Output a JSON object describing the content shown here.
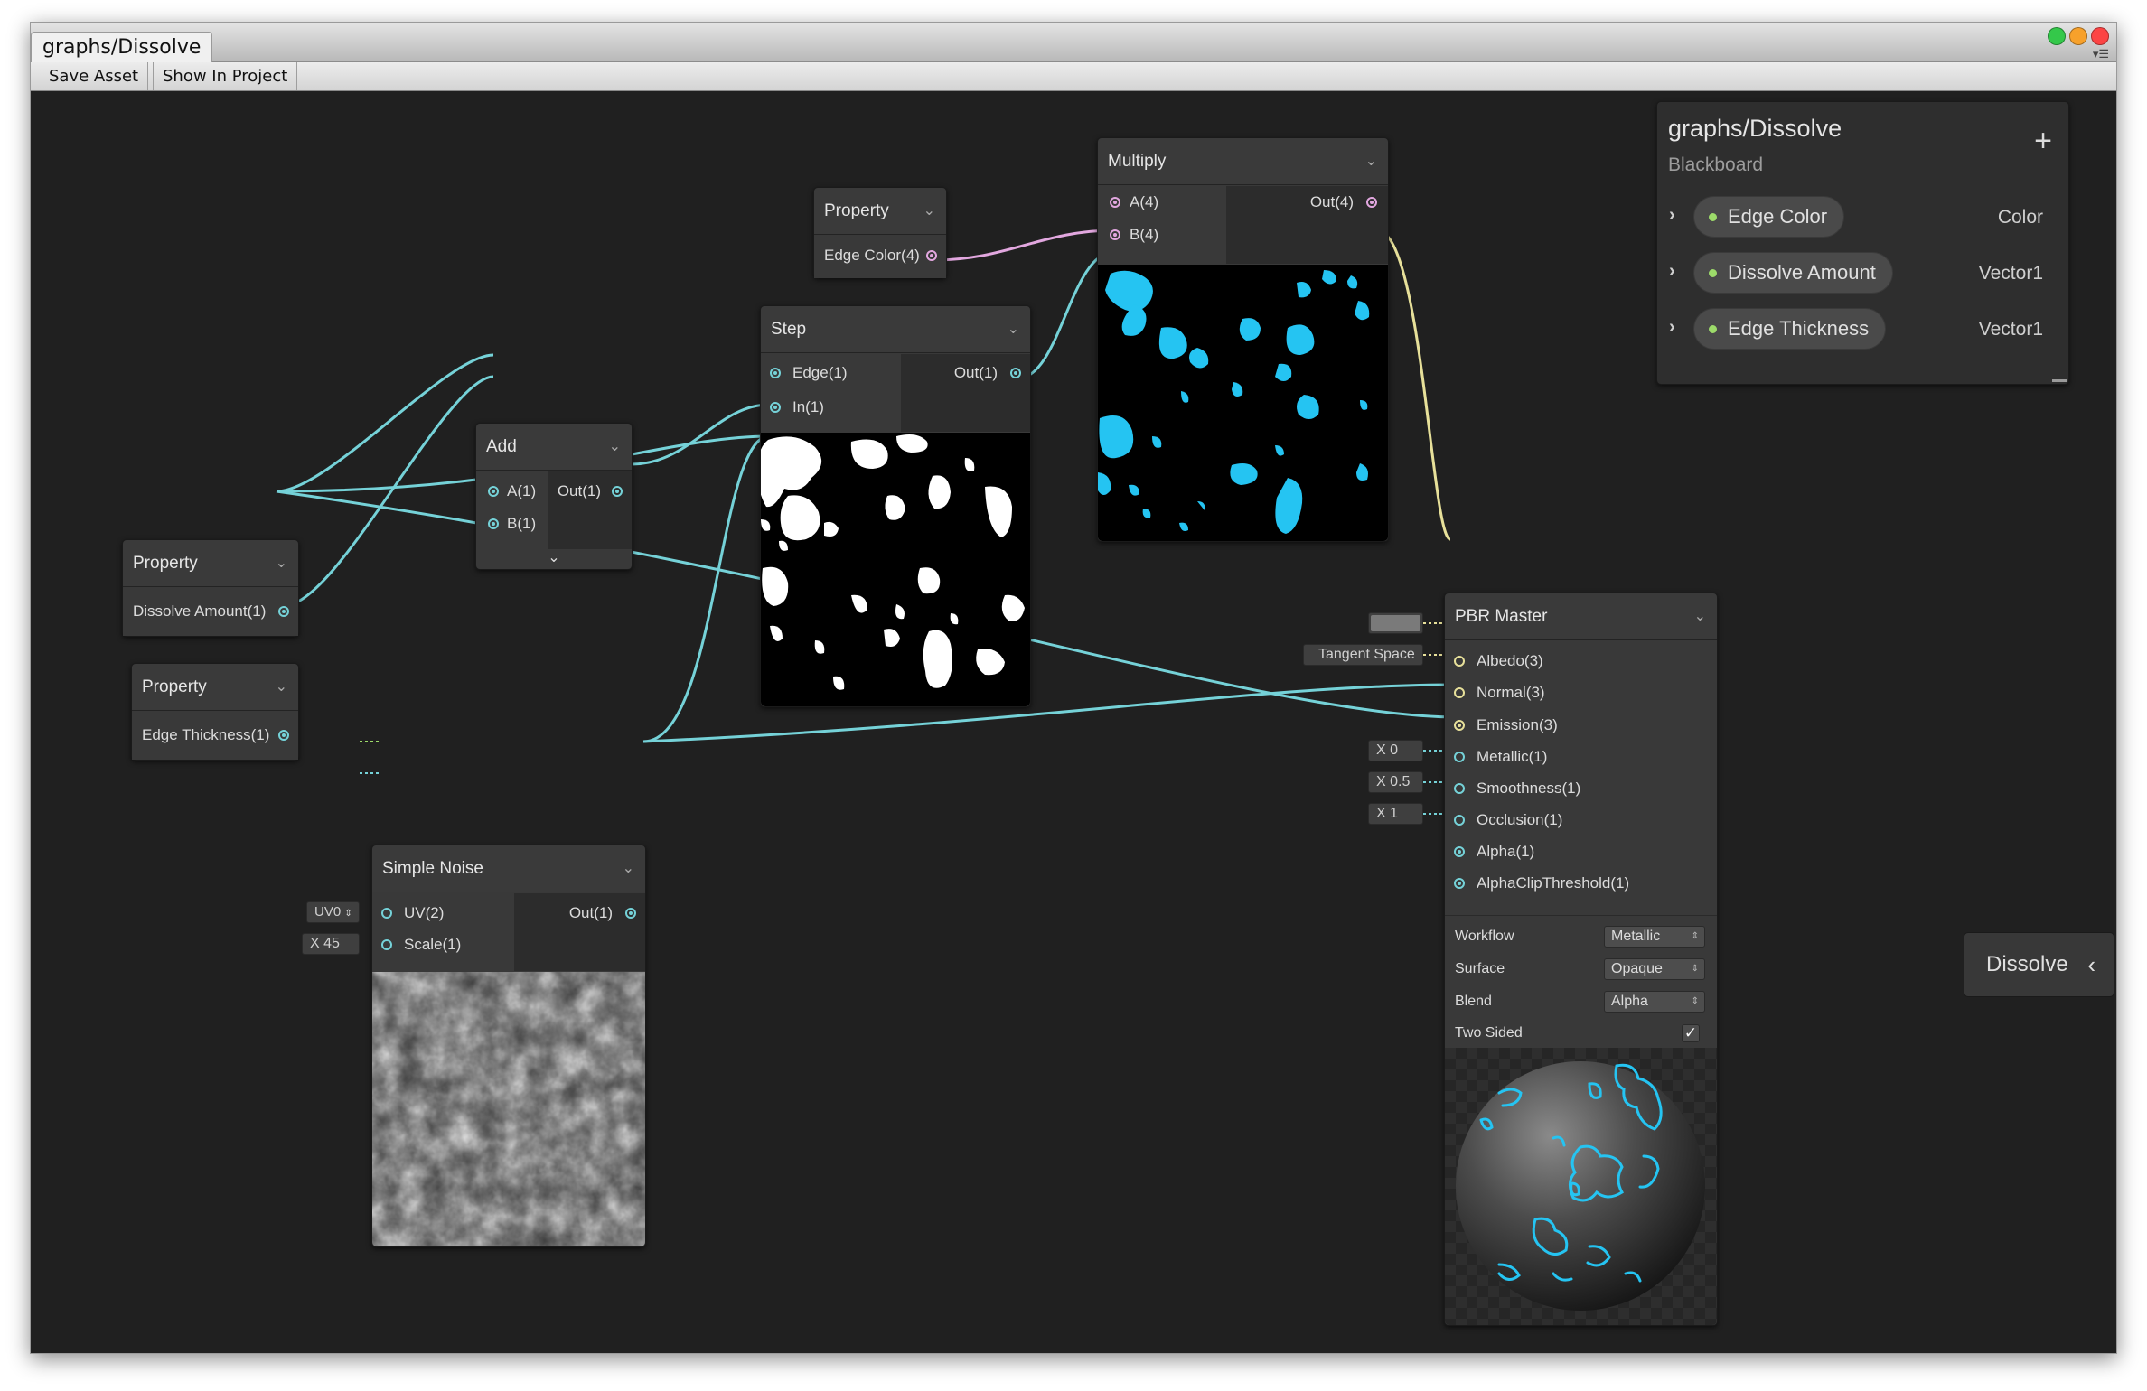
{
  "window": {
    "tab_title": "graphs/Dissolve",
    "traffic_lights": [
      "#34c84a",
      "#f7a12b",
      "#fc4444"
    ],
    "menu_icon": "window-menu-icon"
  },
  "toolbar": {
    "save_asset": "Save Asset",
    "show_in_project": "Show In Project"
  },
  "colors": {
    "wire_vector1": "#75d2d8",
    "wire_vector4": "#e2a7df",
    "wire_vector3": "#e7e09a",
    "edge_color": "#25c4f2"
  },
  "nodes": {
    "prop_edge_color": {
      "title": "Property",
      "output": "Edge Color(4)"
    },
    "prop_dissolve": {
      "title": "Property",
      "output": "Dissolve Amount(1)"
    },
    "prop_thickness": {
      "title": "Property",
      "output": "Edge Thickness(1)"
    },
    "add": {
      "title": "Add",
      "inputs": [
        "A(1)",
        "B(1)"
      ],
      "output": "Out(1)"
    },
    "step": {
      "title": "Step",
      "inputs": [
        "Edge(1)",
        "In(1)"
      ],
      "output": "Out(1)"
    },
    "multiply": {
      "title": "Multiply",
      "inputs": [
        "A(4)",
        "B(4)"
      ],
      "output": "Out(4)"
    },
    "noise": {
      "title": "Simple Noise",
      "inputs": [
        "UV(2)",
        "Scale(1)"
      ],
      "output": "Out(1)",
      "uv_field": "UV0",
      "scale_field": "X  45"
    },
    "pbr": {
      "title": "PBR Master",
      "inputs": [
        "Albedo(3)",
        "Normal(3)",
        "Emission(3)",
        "Metallic(1)",
        "Smoothness(1)",
        "Occlusion(1)",
        "Alpha(1)",
        "AlphaClipThreshold(1)"
      ],
      "normal_field": "Tangent Space",
      "metallic_field": "X  0",
      "smoothness_field": "X  0.5",
      "occlusion_field": "X  1",
      "settings": [
        {
          "label": "Workflow",
          "value": "Metallic"
        },
        {
          "label": "Surface",
          "value": "Opaque"
        },
        {
          "label": "Blend",
          "value": "Alpha"
        }
      ],
      "two_sided_label": "Two Sided",
      "two_sided": true
    }
  },
  "blackboard": {
    "title": "graphs/Dissolve",
    "subtitle": "Blackboard",
    "add_icon": "plus-icon",
    "properties": [
      {
        "name": "Edge Color",
        "type": "Color"
      },
      {
        "name": "Dissolve Amount",
        "type": "Vector1"
      },
      {
        "name": "Edge Thickness",
        "type": "Vector1"
      }
    ]
  },
  "collapsed_tab": {
    "label": "Dissolve"
  }
}
